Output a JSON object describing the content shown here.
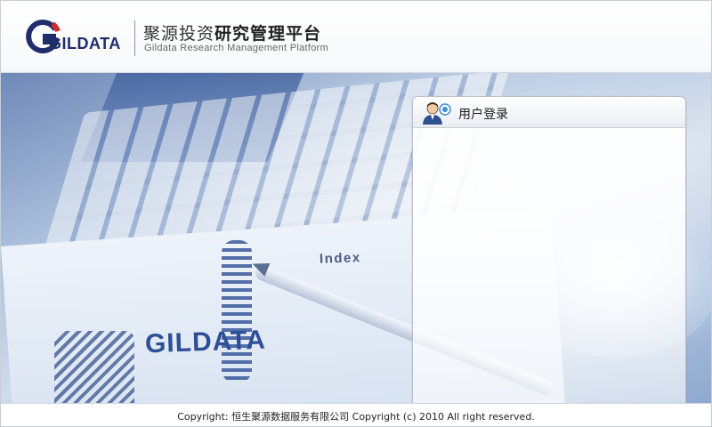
{
  "header": {
    "logo_text": "GILDATA",
    "title_cn_light": "聚源投资",
    "title_cn_bold": "研究管理平台",
    "title_en": "Gildata Research Management Platform"
  },
  "banner": {
    "paper_brand": "GILDATA",
    "paper_index": "Index"
  },
  "login": {
    "title": "用户登录",
    "icon": "user-login-icon"
  },
  "footer": {
    "copyright": "Copyright: 恒生聚源数据服务有限公司  Copyright (c) 2010 All right reserved."
  },
  "colors": {
    "brand_blue": "#1f2d6b",
    "logo_red": "#d22b2b",
    "panel_border": "#b8c0cc"
  }
}
